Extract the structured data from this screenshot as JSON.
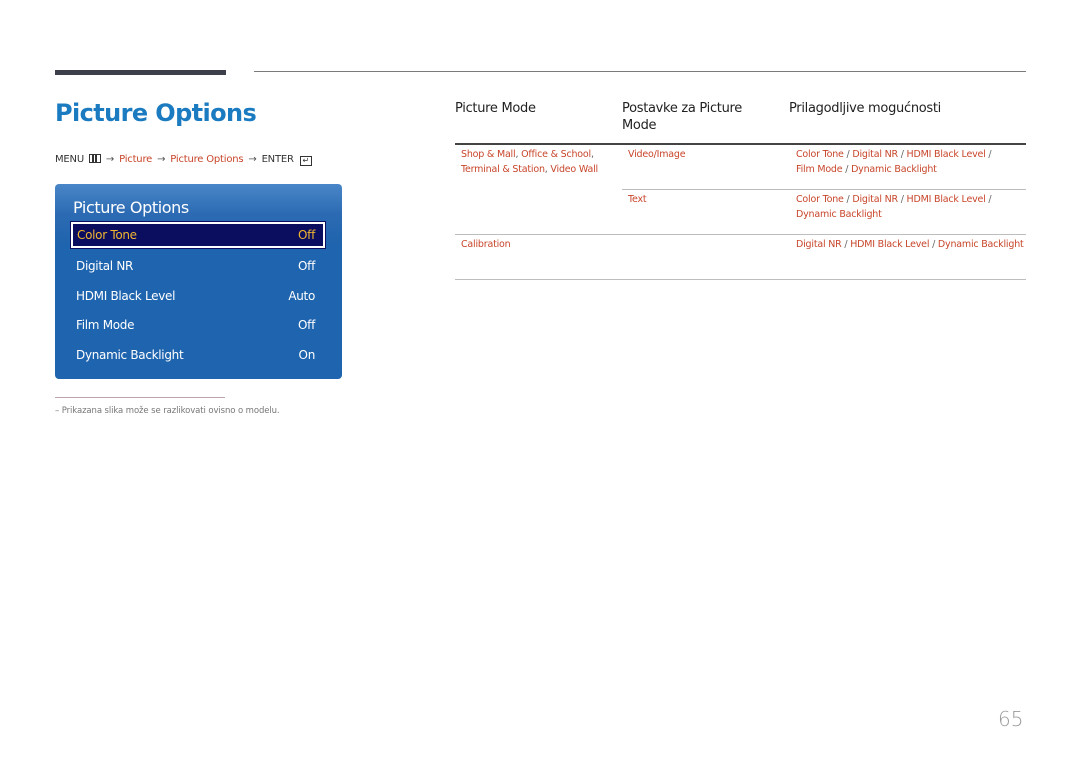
{
  "page_title": "Picture Options",
  "menu_path": {
    "menu_label": "MENU",
    "menu_icon": "menu-grid-icon",
    "arrow": "→",
    "step1": "Picture",
    "step2": "Picture Options",
    "enter_label": "ENTER",
    "enter_icon": "enter-icon",
    "enter_glyph": "↵"
  },
  "osd": {
    "title": "Picture Options",
    "items": [
      {
        "label": "Color Tone",
        "value": "Off",
        "selected": true
      },
      {
        "label": "Digital NR",
        "value": "Off",
        "selected": false
      },
      {
        "label": "HDMI Black Level",
        "value": "Auto",
        "selected": false
      },
      {
        "label": "Film Mode",
        "value": "Off",
        "selected": false
      },
      {
        "label": "Dynamic Backlight",
        "value": "On",
        "selected": false
      }
    ]
  },
  "footnote": "–  Prikazana slika može se razlikovati ovisno o modelu.",
  "table": {
    "headers": [
      "Picture Mode",
      "Postavke za Picture Mode",
      "Prilagodljive mogućnosti"
    ],
    "rows": [
      {
        "picture_mode": [
          "Shop & Mall",
          "Office & School",
          "Terminal & Station",
          "Video Wall"
        ],
        "setting": "Video/Image",
        "options": [
          "Color Tone",
          "Digital NR",
          "HDMI Black Level",
          "Film Mode",
          "Dynamic Backlight"
        ]
      },
      {
        "picture_mode": [],
        "setting": "Text",
        "options": [
          "Color Tone",
          "Digital NR",
          "HDMI Black Level",
          "Dynamic Backlight"
        ]
      },
      {
        "picture_mode": [
          "Calibration"
        ],
        "setting": "",
        "options": [
          "Digital NR",
          "HDMI Black Level",
          "Dynamic Backlight"
        ]
      }
    ]
  },
  "page_number": "65",
  "colors": {
    "title_blue": "#1b7bc0",
    "link_orange": "#c8452a",
    "osd_blue": "#1f64ae",
    "osd_selected_bg": "#0b0e5e",
    "osd_selected_text": "#f0b431"
  }
}
